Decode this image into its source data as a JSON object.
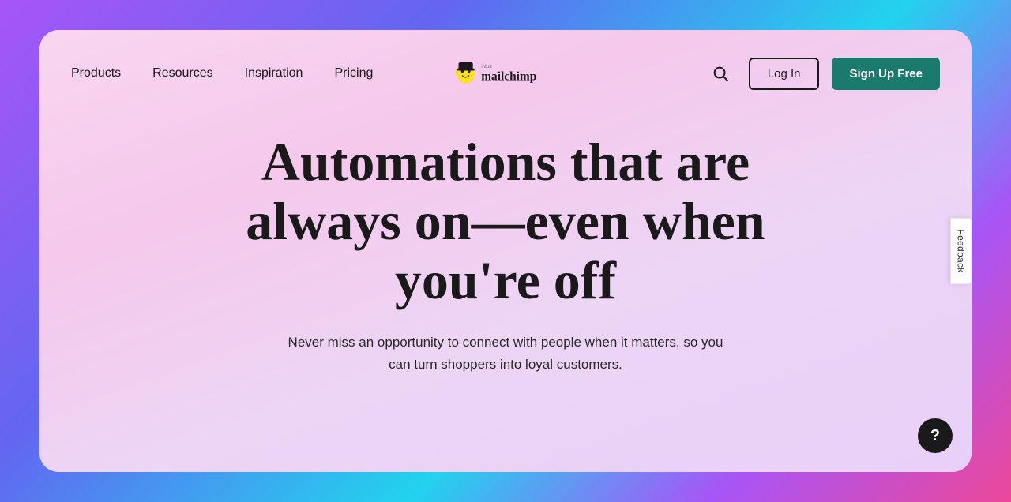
{
  "brand": {
    "logo_alt": "Intuit Mailchimp"
  },
  "navbar": {
    "items": [
      {
        "label": "Products",
        "id": "products"
      },
      {
        "label": "Resources",
        "id": "resources"
      },
      {
        "label": "Inspiration",
        "id": "inspiration"
      },
      {
        "label": "Pricing",
        "id": "pricing"
      }
    ],
    "login_label": "Log In",
    "signup_label": "Sign Up Free",
    "search_aria": "Search"
  },
  "hero": {
    "title": "Automations that are always on—even when you're off",
    "subtitle": "Never miss an opportunity to connect with people when it matters, so you can turn shoppers into loyal customers."
  },
  "feedback": {
    "label": "Feedback"
  },
  "help": {
    "label": "?"
  },
  "colors": {
    "signup_bg": "#1a7a6e",
    "text_dark": "#1a1a1a"
  }
}
